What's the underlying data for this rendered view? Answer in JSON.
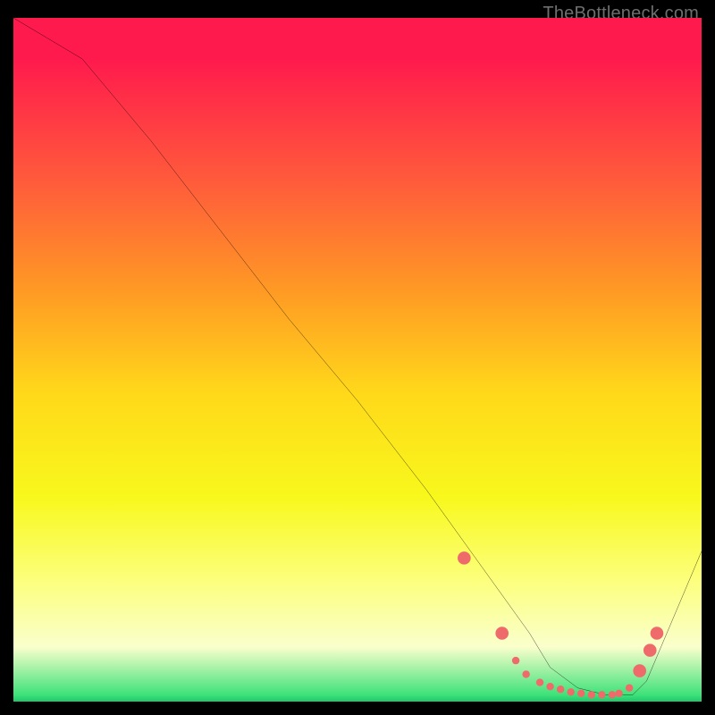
{
  "watermark": "TheBottleneck.com",
  "chart_data": {
    "type": "line",
    "title": "",
    "xlabel": "",
    "ylabel": "",
    "xlim": [
      0,
      100
    ],
    "ylim": [
      0,
      100
    ],
    "series": [
      {
        "name": "curve",
        "x": [
          0,
          5,
          10,
          20,
          30,
          40,
          50,
          60,
          65,
          70,
          75,
          78,
          82,
          86,
          90,
          92,
          100
        ],
        "y": [
          100,
          97,
          94,
          82,
          69,
          56,
          44,
          31,
          24,
          17,
          10,
          5,
          2,
          1,
          1,
          3,
          22
        ]
      }
    ],
    "markers": {
      "color": "#ef6b6b",
      "radius_small": 3.5,
      "radius_big": 6,
      "points": [
        {
          "x": 65.5,
          "y": 21,
          "r": "big"
        },
        {
          "x": 71.0,
          "y": 10,
          "r": "big"
        },
        {
          "x": 73.0,
          "y": 6,
          "r": "small"
        },
        {
          "x": 74.5,
          "y": 4,
          "r": "small"
        },
        {
          "x": 76.5,
          "y": 2.8,
          "r": "small"
        },
        {
          "x": 78.0,
          "y": 2.2,
          "r": "small"
        },
        {
          "x": 79.5,
          "y": 1.8,
          "r": "small"
        },
        {
          "x": 81.0,
          "y": 1.4,
          "r": "small"
        },
        {
          "x": 82.5,
          "y": 1.2,
          "r": "small"
        },
        {
          "x": 84.0,
          "y": 1.0,
          "r": "small"
        },
        {
          "x": 85.5,
          "y": 1.0,
          "r": "small"
        },
        {
          "x": 87.0,
          "y": 1.0,
          "r": "small"
        },
        {
          "x": 88.0,
          "y": 1.2,
          "r": "small"
        },
        {
          "x": 89.5,
          "y": 2.0,
          "r": "small"
        },
        {
          "x": 91.0,
          "y": 4.5,
          "r": "big"
        },
        {
          "x": 92.5,
          "y": 7.5,
          "r": "big"
        },
        {
          "x": 93.5,
          "y": 10,
          "r": "big"
        }
      ]
    }
  }
}
